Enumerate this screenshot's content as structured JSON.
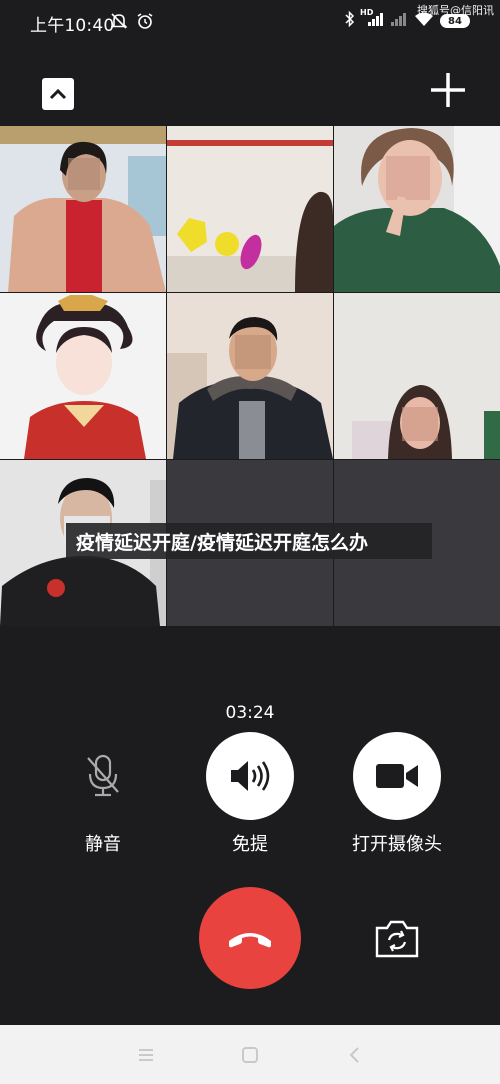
{
  "status_bar": {
    "time": "上午10:40",
    "network_label": "HD",
    "battery_level": "84",
    "watermark": "搜狐号@信阳讯"
  },
  "call": {
    "title_banner": "疫情延迟开庭/疫情延迟开庭怎么办",
    "timer": "03:24"
  },
  "controls": {
    "mute_label": "静音",
    "speaker_label": "免提",
    "camera_label": "打开摄像头"
  },
  "colors": {
    "background": "#1c1c1e",
    "hangup": "#e8433f",
    "control_active": "#ffffff",
    "empty_tile": "#3a3a3e"
  },
  "icons": {
    "collapse": "chevron-up-icon",
    "add": "plus-icon",
    "mute": "microphone-off-icon",
    "speaker": "speaker-icon",
    "camera": "video-camera-icon",
    "hangup": "phone-hangup-icon",
    "switch_camera": "camera-switch-icon"
  }
}
